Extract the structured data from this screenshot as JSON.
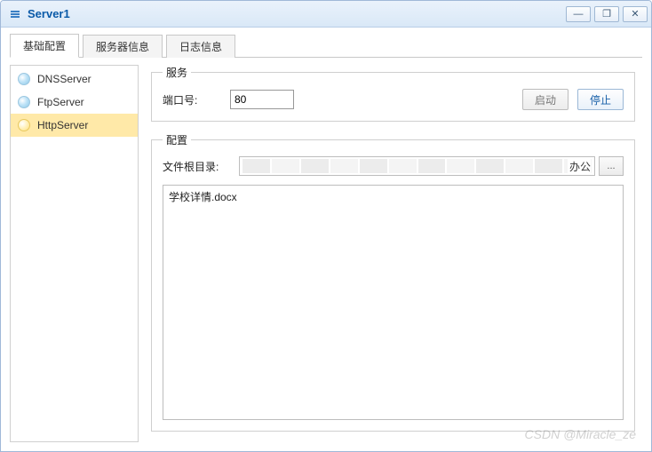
{
  "window": {
    "title": "Server1"
  },
  "tabs": [
    {
      "label": "基础配置",
      "active": true
    },
    {
      "label": "服务器信息",
      "active": false
    },
    {
      "label": "日志信息",
      "active": false
    }
  ],
  "sidebar": {
    "items": [
      {
        "label": "DNSServer",
        "active": false
      },
      {
        "label": "FtpServer",
        "active": false
      },
      {
        "label": "HttpServer",
        "active": true
      }
    ]
  },
  "service": {
    "legend": "服务",
    "port_label": "端口号:",
    "port_value": "80",
    "start_label": "启动",
    "stop_label": "停止"
  },
  "config": {
    "legend": "配置",
    "root_label": "文件根目录:",
    "root_value_tail": "办公",
    "browse_label": "...",
    "files": [
      "学校详情.docx"
    ]
  },
  "watermark": "CSDN @Miracle_ze"
}
